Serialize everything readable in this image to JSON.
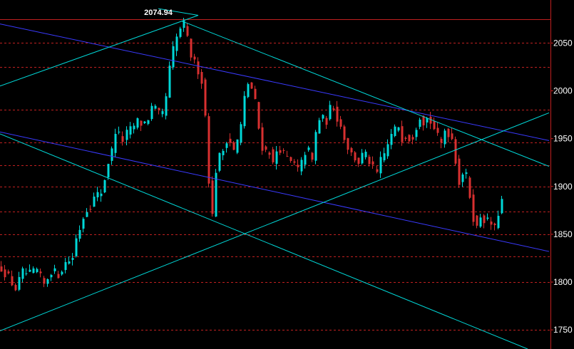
{
  "chart_data": {
    "type": "candlestick",
    "ylim": [
      1730,
      2095
    ],
    "y_ticks": [
      "2050",
      "2000",
      "1950",
      "1900",
      "1850",
      "1800",
      "1750"
    ],
    "y_tick_values": [
      2050,
      2000,
      1950,
      1900,
      1850,
      1800,
      1750
    ],
    "peak_label": "2074.94",
    "peak_value": 2074.94,
    "horizontal_levels": [
      2075,
      2050,
      2025,
      1980,
      1946,
      1922,
      1900,
      1874,
      1850,
      1827,
      1800,
      1750
    ],
    "candle_count": 141,
    "price_path": [
      [
        0,
        1815
      ],
      [
        10,
        1805
      ],
      [
        20,
        1793
      ],
      [
        30,
        1810
      ],
      [
        40,
        1808
      ],
      [
        50,
        1812
      ],
      [
        60,
        1797
      ],
      [
        70,
        1812
      ],
      [
        80,
        1808
      ],
      [
        90,
        1820
      ],
      [
        100,
        1825
      ],
      [
        105,
        1845
      ],
      [
        112,
        1860
      ],
      [
        118,
        1875
      ],
      [
        125,
        1880
      ],
      [
        132,
        1890
      ],
      [
        140,
        1893
      ],
      [
        146,
        1910
      ],
      [
        150,
        1925
      ],
      [
        155,
        1935
      ],
      [
        162,
        1965
      ],
      [
        168,
        1945
      ],
      [
        175,
        1955
      ],
      [
        182,
        1960
      ],
      [
        190,
        1968
      ],
      [
        198,
        1965
      ],
      [
        205,
        1970
      ],
      [
        212,
        1985
      ],
      [
        220,
        1975
      ],
      [
        228,
        1975
      ],
      [
        233,
        2010
      ],
      [
        238,
        2035
      ],
      [
        243,
        2050
      ],
      [
        248,
        2060
      ],
      [
        254,
        2072
      ],
      [
        258,
        2065
      ],
      [
        264,
        2040
      ],
      [
        270,
        2030
      ],
      [
        277,
        2020
      ],
      [
        283,
        2005
      ],
      [
        288,
        1950
      ],
      [
        292,
        1890
      ],
      [
        296,
        1868
      ],
      [
        300,
        1915
      ],
      [
        305,
        1930
      ],
      [
        312,
        1940
      ],
      [
        318,
        1955
      ],
      [
        325,
        1935
      ],
      [
        332,
        1950
      ],
      [
        338,
        1970
      ],
      [
        342,
        2000
      ],
      [
        347,
        2010
      ],
      [
        352,
        2000
      ],
      [
        357,
        1985
      ],
      [
        362,
        1955
      ],
      [
        368,
        1935
      ],
      [
        375,
        1940
      ],
      [
        382,
        1920
      ],
      [
        388,
        1945
      ],
      [
        394,
        1935
      ],
      [
        400,
        1930
      ],
      [
        406,
        1925
      ],
      [
        412,
        1922
      ],
      [
        418,
        1915
      ],
      [
        425,
        1935
      ],
      [
        430,
        1940
      ],
      [
        436,
        1925
      ],
      [
        442,
        1960
      ],
      [
        448,
        1975
      ],
      [
        455,
        1965
      ],
      [
        460,
        1980
      ],
      [
        466,
        1985
      ],
      [
        472,
        1970
      ],
      [
        478,
        1960
      ],
      [
        484,
        1945
      ],
      [
        490,
        1935
      ],
      [
        496,
        1930
      ],
      [
        502,
        1925
      ],
      [
        508,
        1935
      ],
      [
        514,
        1930
      ],
      [
        520,
        1920
      ],
      [
        526,
        1912
      ],
      [
        532,
        1928
      ],
      [
        538,
        1935
      ],
      [
        544,
        1950
      ],
      [
        550,
        1957
      ],
      [
        556,
        1965
      ],
      [
        562,
        1950
      ],
      [
        568,
        1955
      ],
      [
        574,
        1948
      ],
      [
        580,
        1960
      ],
      [
        586,
        1975
      ],
      [
        592,
        1968
      ],
      [
        598,
        1972
      ],
      [
        604,
        1965
      ],
      [
        610,
        1955
      ],
      [
        616,
        1942
      ],
      [
        622,
        1960
      ],
      [
        628,
        1955
      ],
      [
        632,
        1950
      ],
      [
        636,
        1935
      ],
      [
        640,
        1900
      ],
      [
        646,
        1915
      ],
      [
        652,
        1910
      ],
      [
        656,
        1895
      ],
      [
        660,
        1875
      ],
      [
        664,
        1860
      ],
      [
        668,
        1855
      ],
      [
        672,
        1870
      ],
      [
        676,
        1865
      ],
      [
        680,
        1868
      ],
      [
        684,
        1858
      ],
      [
        688,
        1862
      ],
      [
        692,
        1855
      ],
      [
        696,
        1870
      ],
      [
        702,
        1885
      ]
    ],
    "trendlines": [
      {
        "color": "#3a3aff",
        "from": [
          0,
          2070
        ],
        "to": [
          770,
          1948
        ]
      },
      {
        "color": "#3a3aff",
        "from": [
          0,
          1957
        ],
        "to": [
          770,
          1832
        ]
      },
      {
        "color": "#00d8d8",
        "from": [
          0,
          2005
        ],
        "to": [
          278,
          2079
        ]
      },
      {
        "color": "#00d8d8",
        "from": [
          255,
          2073
        ],
        "to": [
          770,
          1921
        ]
      },
      {
        "color": "#00d8d8",
        "from": [
          0,
          1955
        ],
        "to": [
          740,
          1730
        ]
      },
      {
        "color": "#00d8d8",
        "from": [
          0,
          1749
        ],
        "to": [
          770,
          1977
        ]
      },
      {
        "color": "#00d8d8",
        "from": [
          222,
          2086
        ],
        "to": [
          278,
          2079
        ]
      }
    ],
    "colors": {
      "background": "#000000",
      "up_candle": "#00d8d8",
      "down_candle": "#d83030",
      "level_line": "#c02020",
      "axis": "#c02020",
      "text": "#ffffff"
    }
  }
}
